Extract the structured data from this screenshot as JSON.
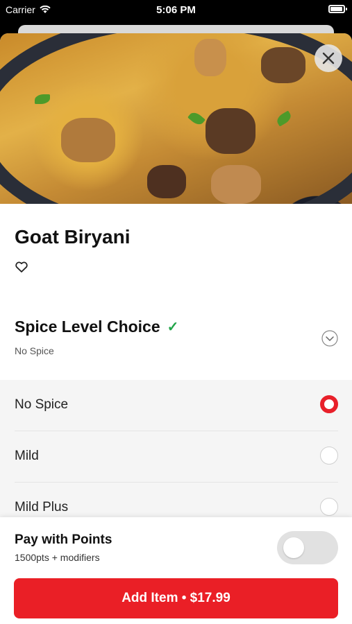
{
  "status_bar": {
    "carrier": "Carrier",
    "time": "5:06 PM"
  },
  "icons": {
    "close": "close-icon",
    "favorite": "heart-outline-icon",
    "expand": "chevron-down-circle-icon",
    "check": "checkmark-icon",
    "wifi": "wifi-icon",
    "battery": "battery-icon"
  },
  "item": {
    "name": "Goat Biryani"
  },
  "modifier_group": {
    "title": "Spice Level Choice",
    "check_glyph": "✓",
    "selected_summary": "No Spice",
    "options": [
      {
        "label": "No Spice",
        "selected": true
      },
      {
        "label": "Mild",
        "selected": false
      },
      {
        "label": "Mild Plus",
        "selected": false
      }
    ]
  },
  "footer": {
    "pay_title": "Pay with Points",
    "pay_subtitle": "1500pts + modifiers",
    "toggle_on": false,
    "add_button": "Add Item • $17.99"
  },
  "colors": {
    "accent": "#ea1f26",
    "check": "#22a54a"
  }
}
